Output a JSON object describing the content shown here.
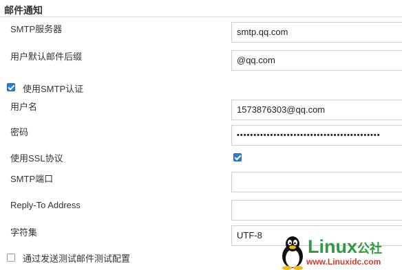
{
  "section": {
    "title": "邮件通知"
  },
  "fields": {
    "smtp_server": {
      "label": "SMTP服务器",
      "value": "smtp.qq.com"
    },
    "default_suffix": {
      "label": "用户默认邮件后缀",
      "value": "@qq.com"
    },
    "use_smtp_auth": {
      "label": "使用SMTP认证",
      "checked": true
    },
    "username": {
      "label": "用户名",
      "value": "1573876303@qq.com"
    },
    "password": {
      "label": "密码",
      "masked": "•••••••••••••••••••••••••••••••••••••••••••"
    },
    "use_ssl": {
      "label": "使用SSL协议",
      "checked": true
    },
    "smtp_port": {
      "label": "SMTP端口",
      "value": ""
    },
    "reply_to": {
      "label": "Reply-To Address",
      "value": ""
    },
    "charset": {
      "label": "字符集",
      "value": "UTF-8"
    },
    "test_config": {
      "label": "通过发送测试邮件测试配置",
      "checked": false
    }
  },
  "watermark": {
    "brand": "Linux",
    "brand_cn": "公社",
    "url": "www.Linuxidc.com"
  },
  "colors": {
    "checkbox_accent": "#2d7cd6",
    "brand_green": "#2e9b3c",
    "url_red": "#d03a2a",
    "border": "#cccccc"
  }
}
